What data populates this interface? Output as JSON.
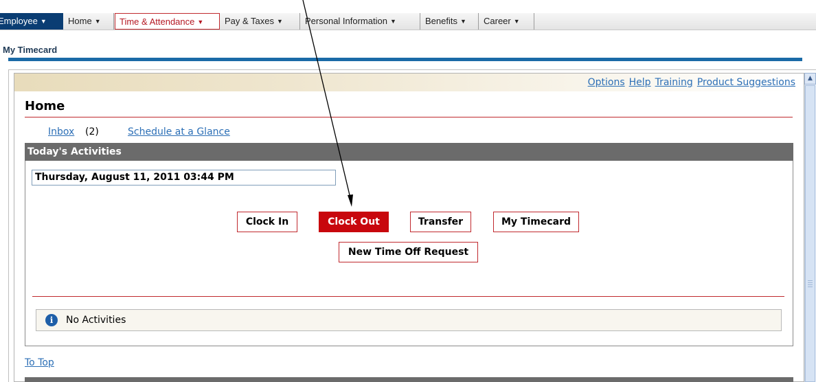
{
  "nav": {
    "employee": "Employee",
    "items": [
      {
        "label": "Home"
      },
      {
        "label": "Time & Attendance"
      },
      {
        "label": "Pay & Taxes"
      },
      {
        "label": "Personal Information"
      },
      {
        "label": "Benefits"
      },
      {
        "label": "Career"
      }
    ],
    "active_index": 1
  },
  "page_title": "My Timecard",
  "top_links": [
    "Options",
    "Help",
    "Training",
    "Product Suggestions"
  ],
  "home": {
    "heading": "Home",
    "inbox_label": "Inbox",
    "inbox_count": "(2)",
    "schedule_link": "Schedule at a Glance"
  },
  "activities": {
    "header": "Today's Activities",
    "datetime": "Thursday, August 11, 2011 03:44 PM",
    "buttons": {
      "clock_in": "Clock In",
      "clock_out": "Clock Out",
      "transfer": "Transfer",
      "my_timecard": "My Timecard",
      "new_time_off": "New Time Off Request"
    },
    "empty_text": "No Activities"
  },
  "to_top": "To Top",
  "colors": {
    "brand_red": "#c8070d",
    "nav_blue": "#0a3d73",
    "link_blue": "#2c6fb6",
    "header_gray": "#6b6b6b"
  }
}
